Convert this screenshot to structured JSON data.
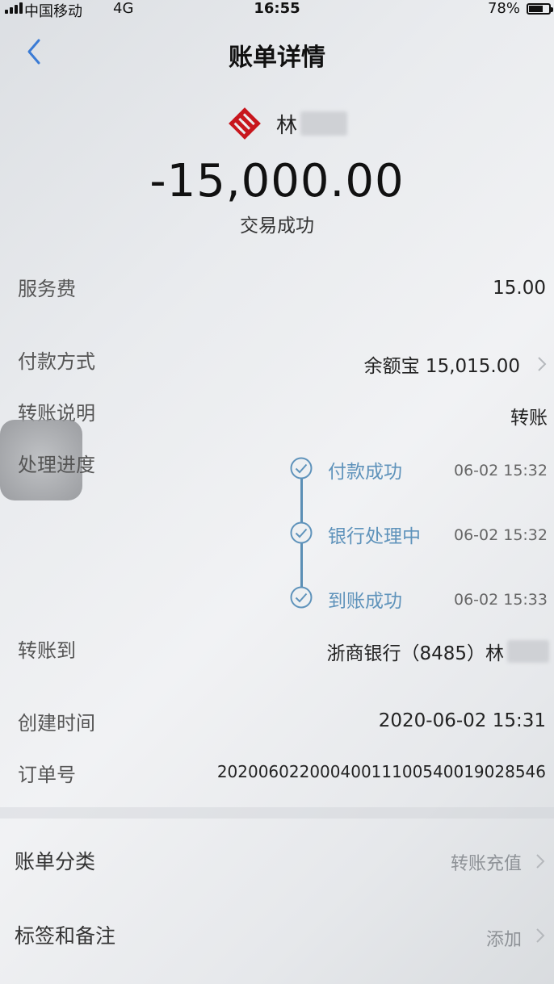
{
  "status_bar": {
    "carrier": "中国移动",
    "network": "4G",
    "time": "16:55",
    "battery": "78%"
  },
  "nav": {
    "title": "账单详情"
  },
  "header": {
    "payee_name": "林",
    "amount": "-15,000.00",
    "status": "交易成功"
  },
  "details": [
    {
      "label": "服务费",
      "value": "15.00"
    },
    {
      "label": "付款方式",
      "value": "余额宝 15,015.00"
    },
    {
      "label": "转账说明",
      "value": "转账"
    },
    {
      "label": "处理进度"
    },
    {
      "label": "转账到",
      "value": "浙商银行（8485）林"
    },
    {
      "label": "创建时间",
      "value": "2020-06-02 15:31"
    },
    {
      "label": "订单号",
      "value": "20200602200040011100540019028546"
    }
  ],
  "progress": [
    {
      "step": "付款成功",
      "time": "06-02 15:32"
    },
    {
      "step": "银行处理中",
      "time": "06-02 15:32"
    },
    {
      "step": "到账成功",
      "time": "06-02 15:33"
    }
  ],
  "sections": [
    {
      "label": "账单分类",
      "value": "转账充值"
    },
    {
      "label": "标签和备注",
      "value": "添加"
    }
  ],
  "colors": {
    "accent": "#5f93bb",
    "logo_red": "#c8161d"
  },
  "battery_level": 0.78
}
